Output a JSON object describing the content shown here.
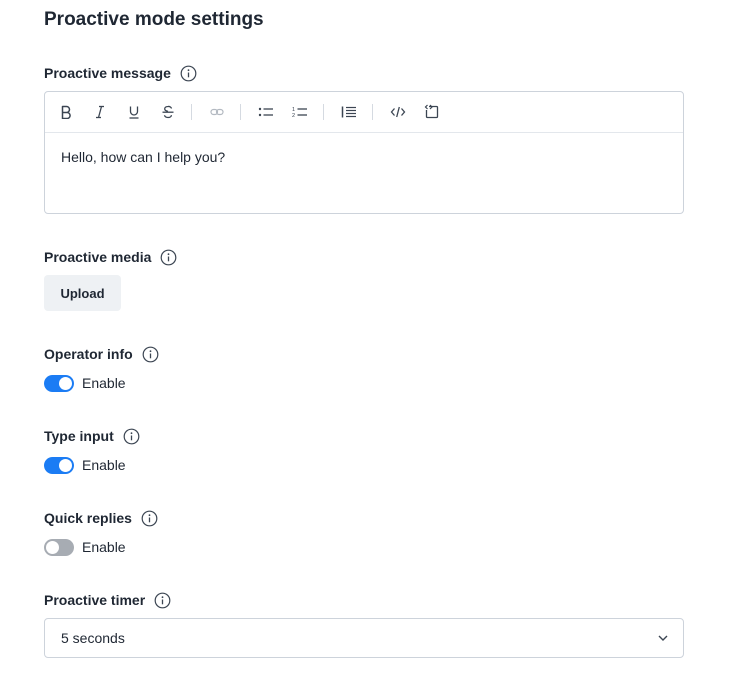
{
  "page": {
    "title": "Proactive mode settings"
  },
  "proactive_message": {
    "label": "Proactive message",
    "value": "Hello, how can I help you?",
    "toolbar": [
      "bold",
      "italic",
      "underline",
      "strikethrough",
      "link",
      "bulleted-list",
      "numbered-list",
      "blockquote",
      "code",
      "code-block"
    ]
  },
  "proactive_media": {
    "label": "Proactive media",
    "upload_label": "Upload"
  },
  "operator_info": {
    "label": "Operator info",
    "toggle_label": "Enable",
    "enabled": true
  },
  "type_input": {
    "label": "Type input",
    "toggle_label": "Enable",
    "enabled": true
  },
  "quick_replies": {
    "label": "Quick replies",
    "toggle_label": "Enable",
    "enabled": false
  },
  "proactive_timer": {
    "label": "Proactive timer",
    "value": "5 seconds"
  },
  "colors": {
    "accent": "#1b7cf4",
    "toggle_off": "#a7acb3",
    "text": "#1f2733"
  }
}
